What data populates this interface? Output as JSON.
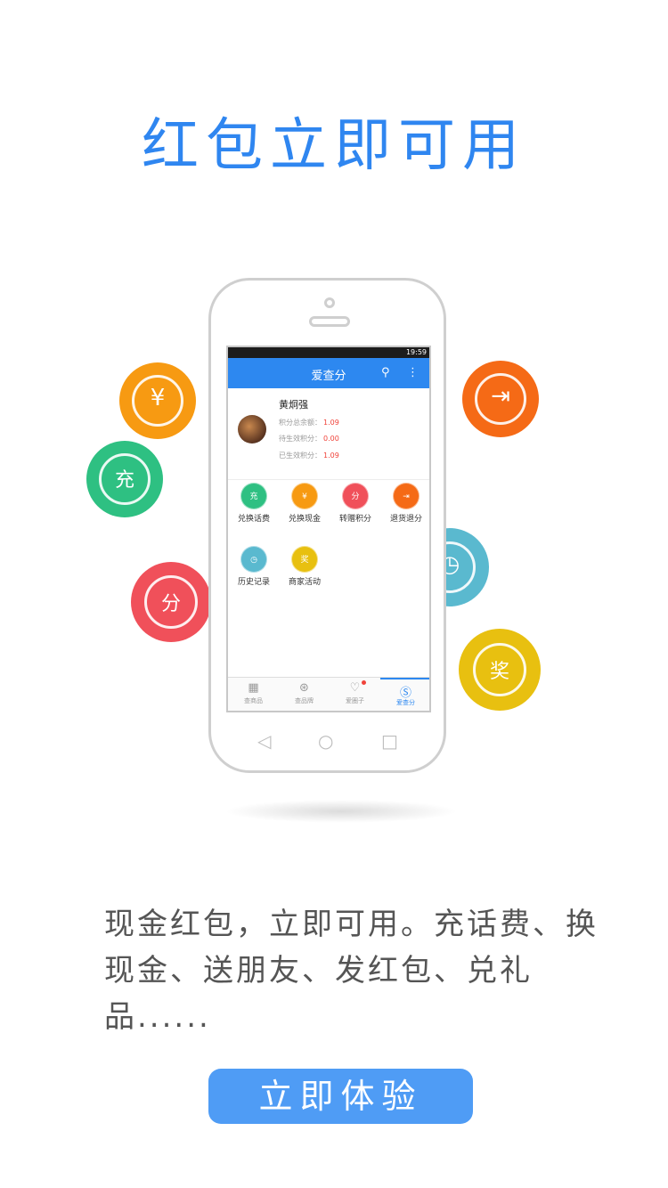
{
  "headline": "红包立即可用",
  "phone": {
    "status_time": "19:59",
    "app_title": "爱查分",
    "user": {
      "name": "黄炯强",
      "rows": [
        {
          "label": "积分总余额：",
          "value": "1.09"
        },
        {
          "label": "待生效积分：",
          "value": "0.00"
        },
        {
          "label": "已生效积分：",
          "value": "1.09"
        }
      ]
    },
    "functions": [
      {
        "label": "兑换话费",
        "glyph": "充",
        "color": "#2ec082"
      },
      {
        "label": "兑换现金",
        "glyph": "¥",
        "color": "#f79a12"
      },
      {
        "label": "转赠积分",
        "glyph": "分",
        "color": "#f0505a"
      },
      {
        "label": "退货退分",
        "glyph": "⇥",
        "color": "#f56a16"
      },
      {
        "label": "历史记录",
        "glyph": "◷",
        "color": "#5ab9cf"
      },
      {
        "label": "商家活动",
        "glyph": "奖",
        "color": "#e8c010"
      }
    ],
    "tabs": [
      {
        "label": "查商品",
        "icon": "barcode-icon"
      },
      {
        "label": "查品牌",
        "icon": "brand-icon"
      },
      {
        "label": "爱圈子",
        "icon": "heart-chat-icon"
      },
      {
        "label": "爱查分",
        "icon": "dollar-icon"
      }
    ]
  },
  "bubbles": {
    "cash": "¥",
    "recharge": "充",
    "points": "分",
    "refund": "⇥",
    "history": "◷",
    "reward": "奖"
  },
  "description": "现金红包，立即可用。充话费、换现金、送朋友、发红包、兑礼品......",
  "cta": "立即体验",
  "colors": {
    "accent": "#2f86f0",
    "green": "#2ec082",
    "orange": "#f79a12",
    "red": "#f0505a",
    "deep_orange": "#f56a16",
    "teal": "#5ab9cf",
    "yellow": "#e8c010"
  }
}
